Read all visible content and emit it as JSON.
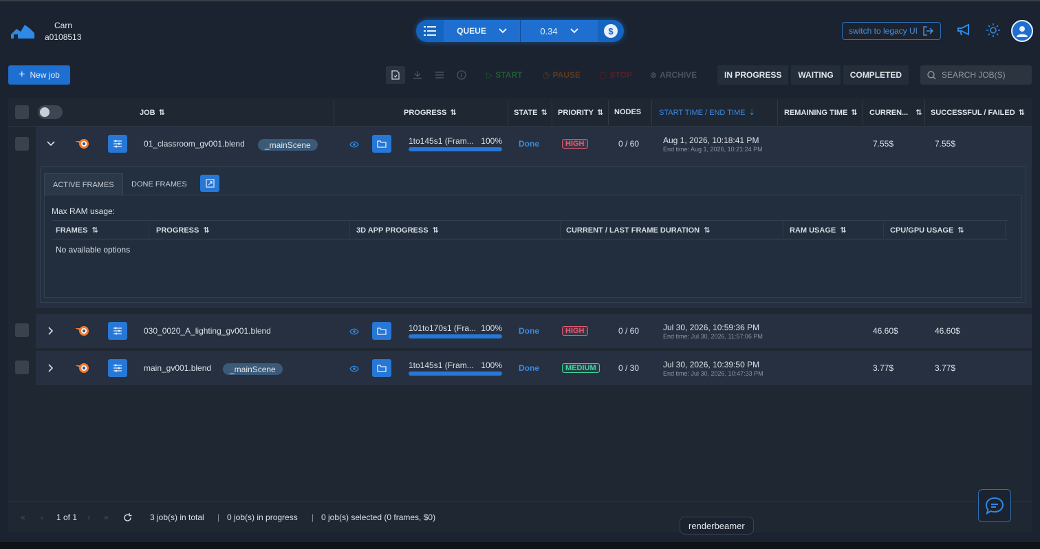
{
  "user": {
    "name": "Carn",
    "id": "a0108513"
  },
  "queue": {
    "label": "QUEUE",
    "price": "0.34"
  },
  "top": {
    "legacy_label": "switch to legacy UI"
  },
  "toolbar": {
    "new_job": "New job",
    "actions": {
      "start": "START",
      "pause": "PAUSE",
      "stop": "STOP",
      "archive": "ARCHIVE"
    },
    "filters": [
      "IN PROGRESS",
      "WAITING",
      "COMPLETED"
    ],
    "search_placeholder": "SEARCH JOB(S)"
  },
  "table": {
    "headers": {
      "job": "JOB",
      "progress": "PROGRESS",
      "state": "STATE",
      "priority": "PRIORITY",
      "nodes": "NODES",
      "start_end": "START TIME / END TIME",
      "remaining": "REMAINING TIME",
      "current": "CURREN...",
      "success_failed": "SUCCESSFUL / FAILED"
    },
    "rows": [
      {
        "name": "01_classroom_gv001.blend",
        "scene": "_mainScene",
        "frames": "1to145s1 (Fram...",
        "percent": "100%",
        "progress": 1.0,
        "state": "Done",
        "priority": "HIGH",
        "nodes": "0 / 60",
        "start": "Aug 1, 2026, 10:18:41 PM",
        "end": "End time: Aug 1, 2026, 10:21:24 PM",
        "current": "7.55$",
        "success": "7.55$"
      },
      {
        "name": "030_0020_A_lighting_gv001.blend",
        "scene": "",
        "frames": "101to170s1 (Fra...",
        "percent": "100%",
        "progress": 1.0,
        "state": "Done",
        "priority": "HIGH",
        "nodes": "0 / 60",
        "start": "Jul 30, 2026, 10:59:36 PM",
        "end": "End time: Jul 30, 2026, 11:57:06 PM",
        "current": "46.60$",
        "success": "46.60$"
      },
      {
        "name": "main_gv001.blend",
        "scene": "_mainScene",
        "frames": "1to145s1 (Fram...",
        "percent": "100%",
        "progress": 1.0,
        "state": "Done",
        "priority": "MEDIUM",
        "nodes": "0 / 30",
        "start": "Jul 30, 2026, 10:39:50 PM",
        "end": "End time: Jul 30, 2026, 10:47:33 PM",
        "current": "3.77$",
        "success": "3.77$"
      }
    ]
  },
  "details": {
    "tabs": [
      "ACTIVE FRAMES",
      "DONE FRAMES"
    ],
    "max_ram": "Max RAM usage:",
    "headers": [
      "FRAMES",
      "PROGRESS",
      "3D APP PROGRESS",
      "CURRENT / LAST FRAME DURATION",
      "RAM USAGE",
      "CPU/GPU USAGE"
    ],
    "empty": "No available options"
  },
  "footer": {
    "page": "1 of 1",
    "total": "3 job(s) in total",
    "in_progress": "0 job(s) in progress",
    "selected": "0 job(s) selected (0 frames, $0)"
  },
  "tooltip": "renderbeamer",
  "colors": {
    "accent": "#1e6fd0",
    "done": "#3d8ae0",
    "high": "#e45b72",
    "medium": "#3fd49a"
  }
}
